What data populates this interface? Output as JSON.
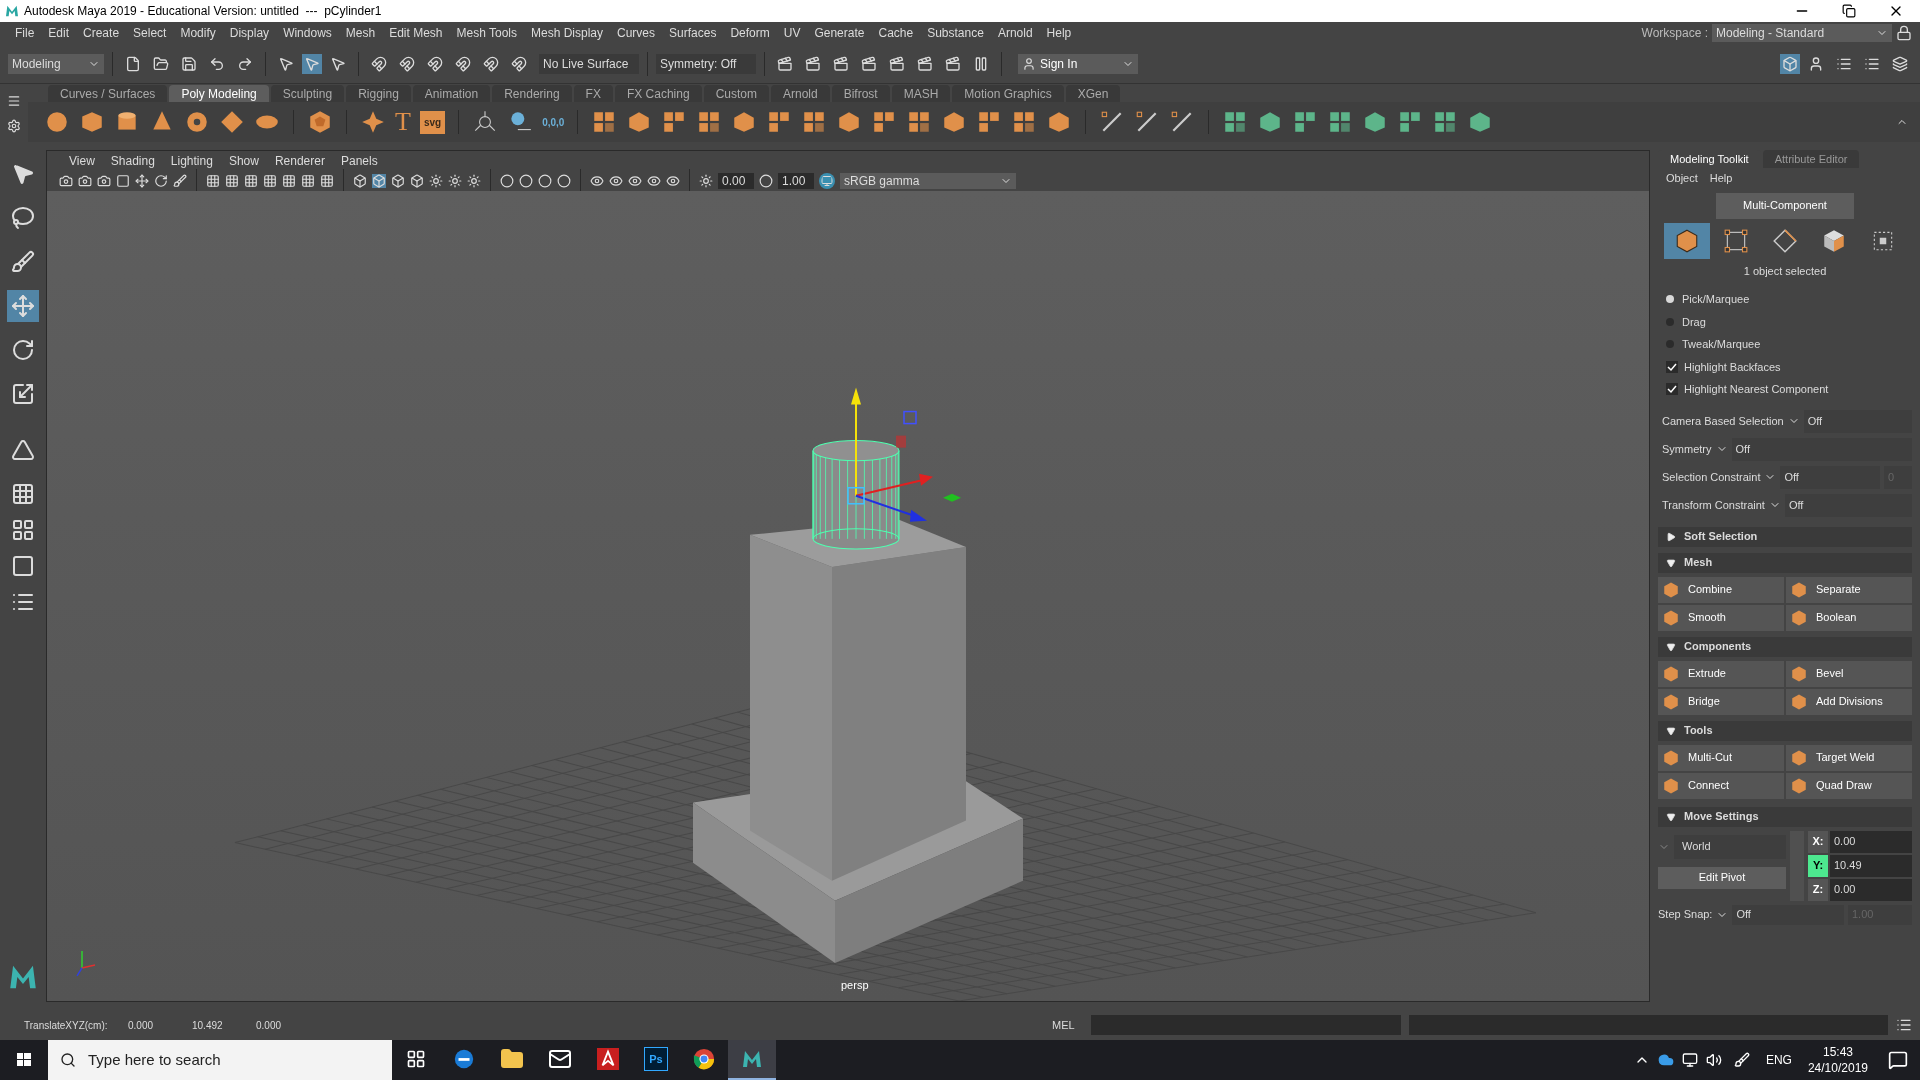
{
  "window": {
    "title": "Autodesk Maya 2019 - Educational Version: untitled  ---  pCylinder1"
  },
  "menu_bar": {
    "items": [
      "File",
      "Edit",
      "Create",
      "Select",
      "Modify",
      "Display",
      "Windows",
      "Mesh",
      "Edit Mesh",
      "Mesh Tools",
      "Mesh Display",
      "Curves",
      "Surfaces",
      "Deform",
      "UV",
      "Generate",
      "Cache",
      "Substance",
      "Arnold",
      "Help"
    ],
    "workspace_label": "Workspace :",
    "workspace": "Modeling - Standard"
  },
  "status_line": {
    "menu_set": "Modeling",
    "live_surface": "No Live Surface",
    "symmetry": "Symmetry: Off",
    "sign_in": "Sign In"
  },
  "shelf": {
    "tabs": [
      {
        "label": "Curves / Surfaces",
        "selected": false
      },
      {
        "label": "Poly Modeling",
        "selected": true
      },
      {
        "label": "Sculpting",
        "selected": false
      },
      {
        "label": "Rigging",
        "selected": false
      },
      {
        "label": "Animation",
        "selected": false
      },
      {
        "label": "Rendering",
        "selected": false
      },
      {
        "label": "FX",
        "selected": false
      },
      {
        "label": "FX Caching",
        "selected": false
      },
      {
        "label": "Custom",
        "selected": false
      },
      {
        "label": "Arnold",
        "selected": false
      },
      {
        "label": "Bifrost",
        "selected": false
      },
      {
        "label": "MASH",
        "selected": false
      },
      {
        "label": "Motion Graphics",
        "selected": false
      },
      {
        "label": "XGen",
        "selected": false
      }
    ],
    "text_icon": "T",
    "svg_icon": "svg",
    "origin_icon": "0,0,0"
  },
  "tools": [
    {
      "kind": "select",
      "selected": false
    },
    {
      "kind": "lasso",
      "selected": false
    },
    {
      "kind": "paint",
      "selected": false
    },
    {
      "kind": "move",
      "selected": true
    },
    {
      "kind": "rotate",
      "selected": false
    },
    {
      "kind": "scale",
      "selected": false
    }
  ],
  "viewport": {
    "menus": [
      "View",
      "Shading",
      "Lighting",
      "Show",
      "Renderer",
      "Panels"
    ],
    "exposure": "0.00",
    "gamma": "1.00",
    "color_space": "sRGB gamma",
    "camera": "persp"
  },
  "side_panel": {
    "tabs": [
      {
        "label": "Modeling Toolkit",
        "selected": true
      },
      {
        "label": "Attribute Editor",
        "selected": false
      }
    ],
    "menus": [
      "Object",
      "Help"
    ],
    "mode": "Multi-Component",
    "component_modes": [
      {
        "kind": "object",
        "selected": true
      },
      {
        "kind": "vertex",
        "selected": false
      },
      {
        "kind": "edge",
        "selected": false
      },
      {
        "kind": "face",
        "selected": false
      },
      {
        "kind": "uv",
        "selected": false
      }
    ],
    "selection_count": "1 object selected",
    "pick_modes": [
      {
        "label": "Pick/Marquee",
        "selected": true
      },
      {
        "label": "Drag",
        "selected": false
      },
      {
        "label": "Tweak/Marquee",
        "selected": false
      }
    ],
    "options": [
      {
        "label": "Highlight Backfaces",
        "checked": true
      },
      {
        "label": "Highlight Nearest Component",
        "checked": true
      }
    ],
    "dropdowns": [
      {
        "label": "Camera Based Selection",
        "value": "Off"
      },
      {
        "label": "Symmetry",
        "value": "Off"
      },
      {
        "label": "Selection Constraint",
        "value": "Off",
        "extra": "0"
      },
      {
        "label": "Transform Constraint",
        "value": "Off"
      }
    ],
    "sections": [
      {
        "title": "Soft Selection",
        "expanded": false
      },
      {
        "title": "Mesh",
        "expanded": true,
        "buttons": [
          "Combine",
          "Separate",
          "Smooth",
          "Boolean"
        ]
      },
      {
        "title": "Components",
        "expanded": true,
        "buttons": [
          "Extrude",
          "Bevel",
          "Bridge",
          "Add Divisions"
        ]
      },
      {
        "title": "Tools",
        "expanded": true,
        "buttons": [
          "Multi-Cut",
          "Target Weld",
          "Connect",
          "Quad Draw"
        ]
      }
    ],
    "move_settings": {
      "title": "Move Settings",
      "expanded": true,
      "space": "World",
      "edit_pivot": "Edit Pivot",
      "axes": [
        {
          "label": "X:",
          "value": "0.00",
          "selected": false
        },
        {
          "label": "Y:",
          "value": "10.49",
          "selected": true
        },
        {
          "label": "Z:",
          "value": "0.00",
          "selected": false
        }
      ],
      "step_snap_label": "Step Snap:",
      "step_snap": "Off",
      "step_value": "1.00"
    }
  },
  "help_line": {
    "label": "TranslateXYZ(cm):",
    "values": [
      "0.000",
      "10.492",
      "0.000"
    ]
  },
  "command_line": {
    "label": "MEL"
  },
  "taskbar": {
    "search_placeholder": "Type here to search",
    "apps": [
      {
        "kind": "task-view",
        "selected": false
      },
      {
        "kind": "browser",
        "selected": false
      },
      {
        "kind": "folder",
        "selected": false
      },
      {
        "kind": "mail",
        "selected": false
      },
      {
        "kind": "pdf",
        "selected": false
      },
      {
        "kind": "ps",
        "label": "Ps",
        "selected": false
      },
      {
        "kind": "chrome",
        "selected": false
      },
      {
        "kind": "maya",
        "selected": true
      }
    ],
    "language": "ENG",
    "time": "15:43",
    "date": "24/10/2019"
  }
}
